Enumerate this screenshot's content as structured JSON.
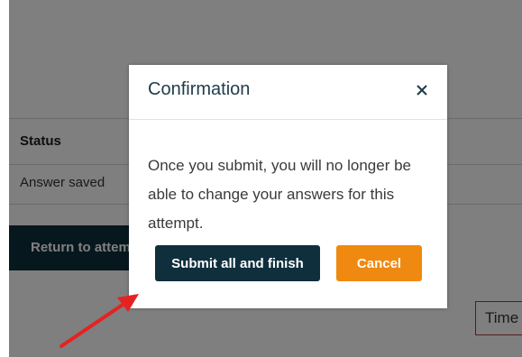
{
  "background": {
    "status_header": "Status",
    "status_value": "Answer saved",
    "return_button_label": "Return to attempt",
    "time_label": "Time left"
  },
  "modal": {
    "title": "Confirmation",
    "body_text": "Once you submit, you will no longer be able to change your answers for this attempt.",
    "submit_label": "Submit all and finish",
    "cancel_label": "Cancel"
  },
  "icons": {
    "close": "close-icon",
    "annotation": "red-arrow-icon"
  },
  "colors": {
    "primary_button": "#0f2f3d",
    "cancel_button": "#f0890f",
    "annotation_arrow": "#e52222",
    "title_text": "#1f3b4a"
  }
}
